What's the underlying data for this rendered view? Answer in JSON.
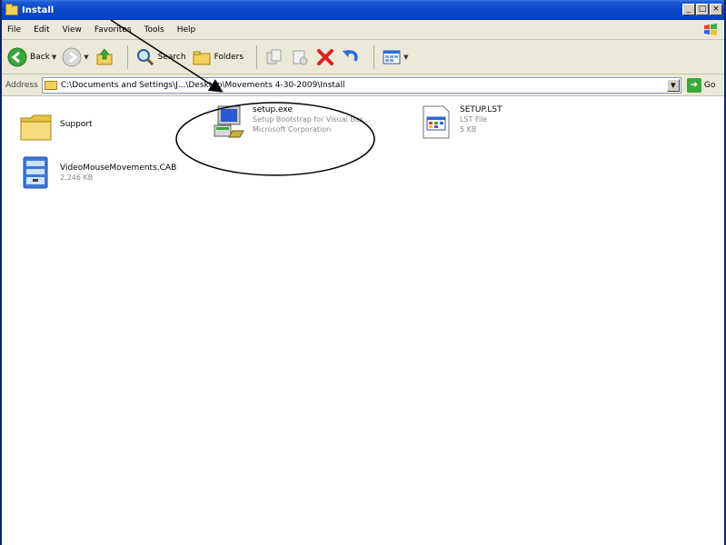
{
  "window": {
    "title": "Install",
    "caption_buttons": [
      "_",
      "□",
      "×"
    ]
  },
  "menu": {
    "items": [
      "File",
      "Edit",
      "View",
      "Favorites",
      "Tools",
      "Help"
    ]
  },
  "toolbar": {
    "back_label": "Back",
    "search_label": "Search",
    "folders_label": "Folders"
  },
  "address": {
    "label": "Address",
    "value": "C:\\Documents and Settings\\J...\\Desktop\\Movements 4-30-2009\\Install",
    "go_label": "Go"
  },
  "files": [
    {
      "name": "Support",
      "lines": []
    },
    {
      "name": "setup.exe",
      "lines": [
        "Setup Bootstrap for Visual Bas...",
        "Microsoft Corporation"
      ]
    },
    {
      "name": "SETUP.LST",
      "lines": [
        "LST File",
        "5 KB"
      ]
    },
    {
      "name": "VideoMouseMovements.CAB",
      "lines": [
        "2,246 KB"
      ]
    }
  ],
  "colors": {
    "titlebar": "#0a46c8",
    "chrome": "#ece9d8",
    "folder": "#f2d15c"
  }
}
